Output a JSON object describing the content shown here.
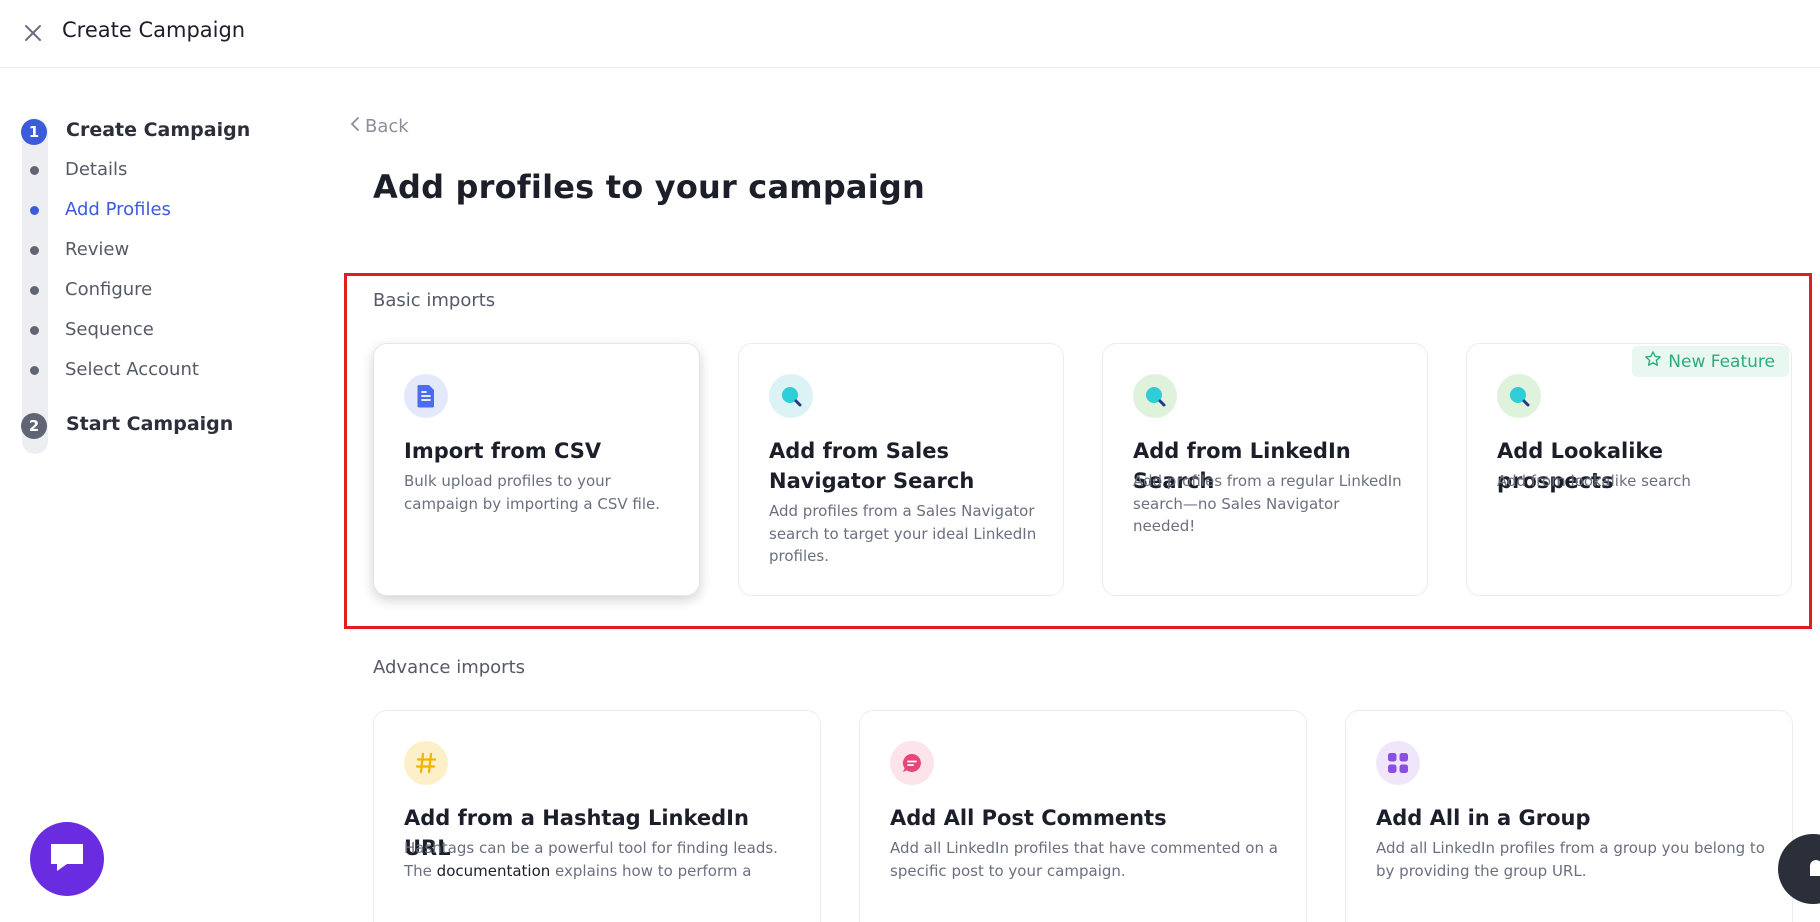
{
  "header": {
    "title": "Create Campaign",
    "close_icon": "close-icon"
  },
  "stepper": {
    "step1": {
      "number": "1",
      "label": "Create Campaign"
    },
    "substeps": [
      {
        "label": "Details",
        "active": false
      },
      {
        "label": "Add Profiles",
        "active": true
      },
      {
        "label": "Review",
        "active": false
      },
      {
        "label": "Configure",
        "active": false
      },
      {
        "label": "Sequence",
        "active": false
      },
      {
        "label": "Select Account",
        "active": false
      }
    ],
    "step2": {
      "number": "2",
      "label": "Start Campaign"
    }
  },
  "main": {
    "back_label": "Back",
    "title": "Add profiles to your campaign",
    "basic": {
      "label": "Basic imports",
      "cards": [
        {
          "title": "Import from CSV",
          "desc": "Bulk upload profiles to your campaign by importing a CSV file.",
          "icon": "document-icon"
        },
        {
          "title": "Add from Sales Navigator Search",
          "desc": "Add profiles from a Sales Navigator search to target your ideal LinkedIn profiles.",
          "icon": "search-icon"
        },
        {
          "title": "Add from LinkedIn Search",
          "desc": "Add profiles from a regular LinkedIn search—no Sales Navigator needed!",
          "icon": "search-icon"
        },
        {
          "title": "Add Lookalike prospects",
          "desc": "Add from lookalike search",
          "icon": "search-icon",
          "badge": "New Feature"
        }
      ]
    },
    "advance": {
      "label": "Advance imports",
      "cards": [
        {
          "title": "Add from a Hashtag LinkedIn URL",
          "desc_pre": "Hashtags can be a powerful tool for finding leads. The ",
          "desc_link": "documentation",
          "desc_post": " explains how to perform a",
          "icon": "hashtag-icon"
        },
        {
          "title": "Add All Post Comments",
          "desc": "Add all LinkedIn profiles that have commented on a specific post to your campaign.",
          "icon": "comment-icon"
        },
        {
          "title": "Add All in a Group",
          "desc": "Add all LinkedIn profiles from a group you belong to by providing the group URL.",
          "icon": "grid-icon"
        }
      ]
    }
  },
  "colors": {
    "accent": "#3b5bdb",
    "highlight": "#e01e1e",
    "badge": "#2fab7a",
    "chat": "#6a2ce0"
  }
}
